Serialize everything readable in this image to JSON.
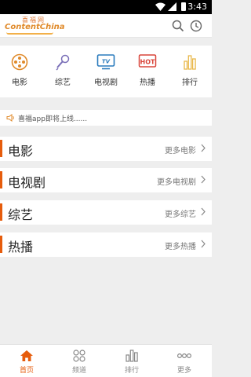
{
  "statusbar": {
    "time": "3:43"
  },
  "header": {
    "logo_cn": "喜福网",
    "logo_en": "ContentChina",
    "icons": [
      "search-icon",
      "history-clock-icon"
    ]
  },
  "categories": [
    {
      "label": "电影",
      "icon": "film-reel-icon"
    },
    {
      "label": "综艺",
      "icon": "microphone-icon"
    },
    {
      "label": "电视剧",
      "icon": "tv-icon"
    },
    {
      "label": "热播",
      "icon": "hot-icon",
      "icon_text": "HOT"
    },
    {
      "label": "排行",
      "icon": "bar-chart-icon"
    }
  ],
  "notice": {
    "text": "喜福app即将上线......",
    "icon": "speaker-icon"
  },
  "sections": [
    {
      "title": "电影",
      "more": "更多电影"
    },
    {
      "title": "电视剧",
      "more": "更多电视剧"
    },
    {
      "title": "综艺",
      "more": "更多综艺"
    },
    {
      "title": "热播",
      "more": "更多热播"
    }
  ],
  "bottom_nav": [
    {
      "label": "首页",
      "icon": "home-icon",
      "active": true
    },
    {
      "label": "频道",
      "icon": "channels-grid-icon",
      "active": false
    },
    {
      "label": "排行",
      "icon": "ranking-icon",
      "active": false
    },
    {
      "label": "更多",
      "icon": "more-dots-icon",
      "active": false
    }
  ],
  "colors": {
    "accent": "#e65c0c",
    "icon_orange": "#e08a2a",
    "icon_blue": "#2a7bbd",
    "icon_purple": "#7a6fb8",
    "icon_red": "#d9453a",
    "icon_gold": "#e9b84c"
  }
}
